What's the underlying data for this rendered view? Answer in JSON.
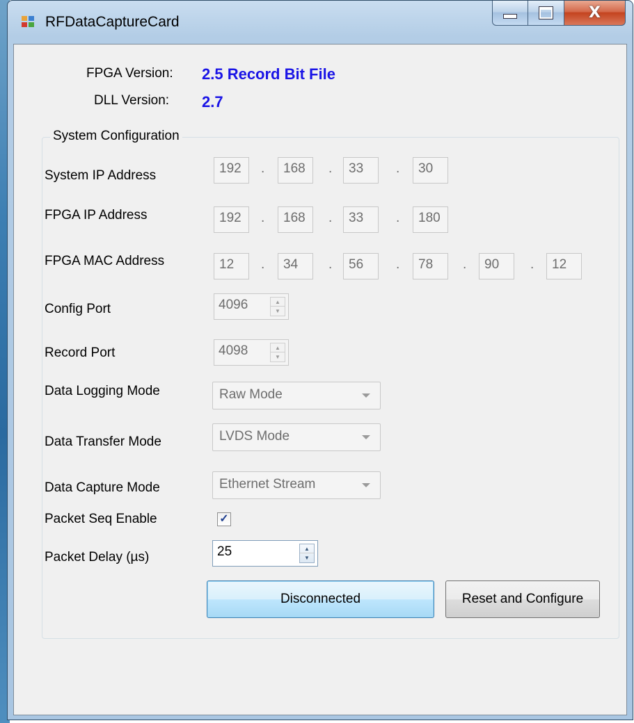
{
  "window": {
    "title": "RFDataCaptureCard",
    "icon": "app-icon",
    "controls": {
      "minimize": "minimize-icon",
      "maximize": "maximize-icon",
      "close_glyph": "X"
    }
  },
  "versions": {
    "fpga_label": "FPGA Version:",
    "fpga_value": "2.5 Record Bit File",
    "dll_label": "DLL Version:",
    "dll_value": "2.7",
    "value_color": "#1a14e6"
  },
  "system_configuration": {
    "title": "System Configuration",
    "system_ip": {
      "label": "System IP Address",
      "octets": [
        "192",
        "168",
        "33",
        "30"
      ]
    },
    "fpga_ip": {
      "label": "FPGA IP Address",
      "octets": [
        "192",
        "168",
        "33",
        "180"
      ]
    },
    "fpga_mac": {
      "label": "FPGA MAC Address",
      "octets": [
        "12",
        "34",
        "56",
        "78",
        "90",
        "12"
      ]
    },
    "separator": ".",
    "config_port": {
      "label": "Config Port",
      "value": "4096"
    },
    "record_port": {
      "label": "Record Port",
      "value": "4098"
    },
    "data_logging_mode": {
      "label": "Data Logging Mode",
      "selected": "Raw Mode"
    },
    "data_transfer_mode": {
      "label": "Data Transfer Mode",
      "selected": "LVDS Mode"
    },
    "data_capture_mode": {
      "label": "Data Capture Mode",
      "selected": "Ethernet Stream"
    },
    "packet_seq_enable": {
      "label": "Packet Seq Enable",
      "checked": true,
      "mark": "✓"
    },
    "packet_delay": {
      "label": "Packet Delay (µs)",
      "value": "25"
    }
  },
  "buttons": {
    "connect": "Disconnected",
    "reset_configure": "Reset and Configure"
  }
}
